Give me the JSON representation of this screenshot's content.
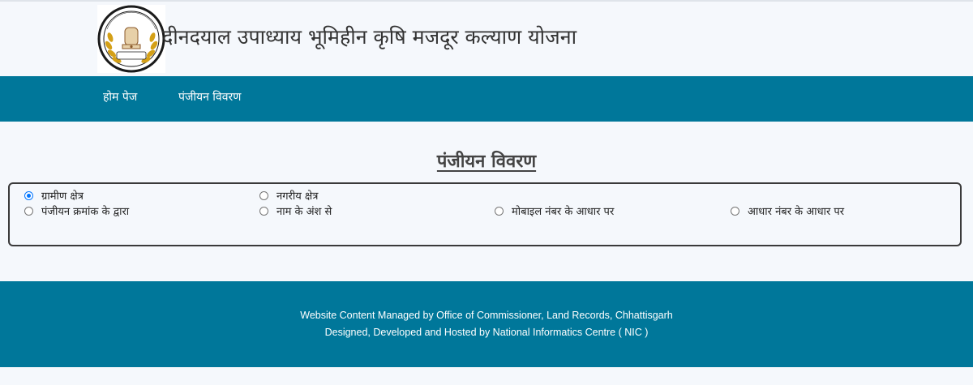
{
  "header": {
    "title": "दीनदयाल उपाध्याय भूमिहीन कृषि मजदूर कल्याण योजना",
    "logo": {
      "emblem_icon": "state-emblem",
      "text": "छत्तीसगढ़ शासन"
    }
  },
  "nav": {
    "items": [
      {
        "label": "होम पेज"
      },
      {
        "label": "पंजीयन विवरण"
      }
    ]
  },
  "main": {
    "heading": "पंजीयन विवरण",
    "area_options": [
      {
        "label": "ग्रामीण क्षेत्र",
        "selected": true
      },
      {
        "label": "नगरीय क्षेत्र",
        "selected": false
      }
    ],
    "search_options": [
      {
        "label": "पंजीयन क्रमांक के द्वारा",
        "selected": false
      },
      {
        "label": "नाम के अंश से",
        "selected": false
      },
      {
        "label": "मोबाइल नंबर के आधार पर",
        "selected": false
      },
      {
        "label": "आधार नंबर के आधार पर",
        "selected": false
      }
    ]
  },
  "footer": {
    "line1": "Website Content Managed by Office of Commissioner, Land Records, Chhattisgarh",
    "line2": "Designed, Developed and Hosted by National Informatics Centre ( NIC )"
  },
  "colors": {
    "primary": "#00779a",
    "background": "#f5f8fc",
    "radio_selected": "#0075ff"
  }
}
